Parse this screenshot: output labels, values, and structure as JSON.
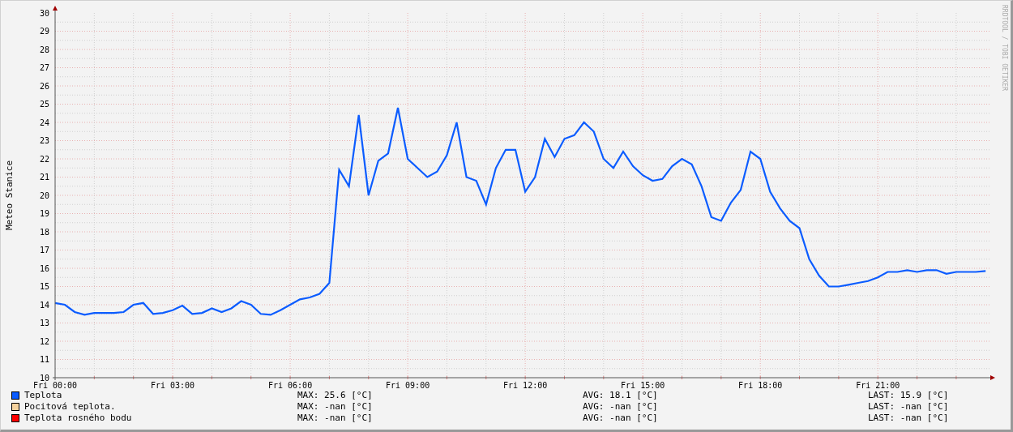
{
  "chart": {
    "credit": "RRDTOOL / TOBI OETIKER",
    "chart_data": {
      "type": "line",
      "ylabel": "Meteo Stanice",
      "categories": [
        "Fri 00:00",
        null,
        null,
        null,
        null,
        null,
        null,
        null,
        null,
        null,
        null,
        null,
        "Fri 03:00",
        null,
        null,
        null,
        null,
        null,
        null,
        null,
        null,
        null,
        null,
        null,
        "Fri 06:00",
        null,
        null,
        null,
        null,
        null,
        null,
        null,
        null,
        null,
        null,
        null,
        "Fri 09:00",
        null,
        null,
        null,
        null,
        null,
        null,
        null,
        null,
        null,
        null,
        null,
        "Fri 12:00",
        null,
        null,
        null,
        null,
        null,
        null,
        null,
        null,
        null,
        null,
        null,
        "Fri 15:00",
        null,
        null,
        null,
        null,
        null,
        null,
        null,
        null,
        null,
        null,
        null,
        "Fri 18:00",
        null,
        null,
        null,
        null,
        null,
        null,
        null,
        null,
        null,
        null,
        null,
        "Fri 21:00",
        null,
        null,
        null,
        null,
        null,
        null,
        null,
        null,
        null,
        null,
        null
      ],
      "series": [
        {
          "name": "Teplota",
          "color": "#0b5cff",
          "values": [
            14.1,
            14.0,
            13.6,
            13.45,
            13.55,
            13.55,
            13.55,
            13.6,
            14.0,
            14.1,
            13.5,
            13.55,
            13.7,
            13.95,
            13.5,
            13.55,
            13.8,
            13.6,
            13.8,
            14.2,
            14.0,
            13.5,
            13.45,
            13.7,
            14.0,
            14.3,
            14.4,
            14.6,
            15.2,
            21.4,
            20.5,
            24.4,
            20.0,
            21.9,
            22.3,
            24.8,
            22.0,
            21.5,
            21.0,
            21.3,
            22.2,
            24.0,
            21.0,
            20.8,
            19.5,
            21.5,
            22.5,
            22.5,
            20.2,
            21.0,
            23.1,
            22.1,
            23.1,
            23.3,
            24.0,
            23.5,
            22.0,
            21.5,
            22.4,
            21.6,
            21.1,
            20.8,
            20.9,
            21.6,
            22.0,
            21.7,
            20.5,
            18.8,
            18.6,
            19.6,
            20.3,
            22.4,
            22.0,
            20.2,
            19.3,
            18.6,
            18.2,
            16.5,
            15.6,
            15.0,
            15.0,
            15.1,
            15.2,
            15.3,
            15.5,
            15.8,
            15.8,
            15.9,
            15.8,
            15.9,
            15.9,
            15.7,
            15.8,
            15.8,
            15.8,
            15.85
          ]
        }
      ],
      "ylim": [
        10,
        30
      ],
      "grid": true,
      "yticks": [
        10,
        11,
        12,
        13,
        14,
        15,
        16,
        17,
        18,
        19,
        20,
        21,
        22,
        23,
        24,
        25,
        26,
        27,
        28,
        29,
        30
      ]
    }
  },
  "legend": [
    {
      "max": "MAX: 25.6 [°C]",
      "avg": "AVG: 18.1 [°C]",
      "last": "LAST: 15.9 [°C]"
    },
    {
      "label": "Pocitová teplota.",
      "color": "#f5d29e",
      "max": "MAX: -nan [°C]",
      "avg": "AVG: -nan [°C]",
      "last": "LAST: -nan [°C]"
    },
    {
      "label": "Teplota rosného bodu",
      "color": "#ff0000",
      "max": "MAX: -nan [°C]",
      "avg": "AVG: -nan [°C]",
      "last": "LAST: -nan [°C]"
    }
  ]
}
